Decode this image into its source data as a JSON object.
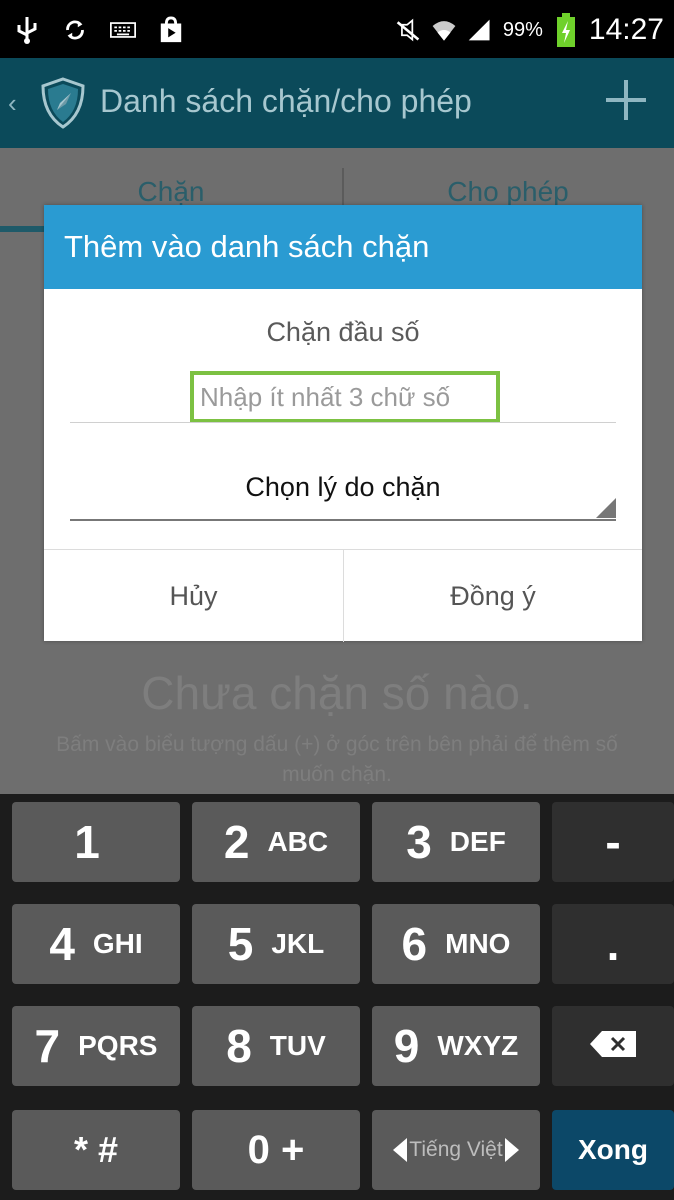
{
  "status_bar": {
    "battery_percent": "99%",
    "time": "14:27",
    "left_icons": [
      "usb-icon",
      "sync-icon",
      "keyboard-icon",
      "play-store-icon"
    ],
    "right_icons": [
      "mute-icon",
      "wifi-icon",
      "signal-icon",
      "battery-charging-icon"
    ]
  },
  "app_bar": {
    "title": "Danh sách chặn/cho phép",
    "add_icon": "plus-icon"
  },
  "tabs": [
    "Chặn",
    "Cho phép"
  ],
  "dialog": {
    "title": "Thêm vào danh sách chặn",
    "subtitle": "Chặn đầu số",
    "input_placeholder": "Nhập ít nhất 3 chữ số",
    "reason_select": "Chọn lý do chặn",
    "cancel": "Hủy",
    "ok": "Đồng ý"
  },
  "empty_state": {
    "title": "Chưa chặn số nào.",
    "description": "Bấm vào biểu tượng dấu (+) ở góc trên bên phải để thêm số muốn chặn."
  },
  "keyboard": {
    "rows": [
      [
        {
          "digit": "1",
          "letters": ""
        },
        {
          "digit": "2",
          "letters": "ABC"
        },
        {
          "digit": "3",
          "letters": "DEF"
        },
        {
          "digit": "-",
          "letters": ""
        }
      ],
      [
        {
          "digit": "4",
          "letters": "GHI"
        },
        {
          "digit": "5",
          "letters": "JKL"
        },
        {
          "digit": "6",
          "letters": "MNO"
        },
        {
          "digit": ".",
          "letters": ""
        }
      ],
      [
        {
          "digit": "7",
          "letters": "PQRS"
        },
        {
          "digit": "8",
          "letters": "TUV"
        },
        {
          "digit": "9",
          "letters": "WXYZ"
        },
        {
          "digit": "",
          "letters": ""
        }
      ],
      [
        {
          "digit": "* #",
          "letters": ""
        },
        {
          "digit": "0 +",
          "letters": ""
        },
        {
          "digit": "Tiếng Việt",
          "letters": ""
        },
        {
          "digit": "Xong",
          "letters": ""
        }
      ]
    ],
    "backspace_icon": "backspace-icon",
    "language": "Tiếng Việt",
    "done": "Xong"
  },
  "colors": {
    "app_bar": "#0b4a5a",
    "dialog_header": "#2a9bd2",
    "input_highlight": "#7cc142",
    "done_key": "#0c4868"
  }
}
